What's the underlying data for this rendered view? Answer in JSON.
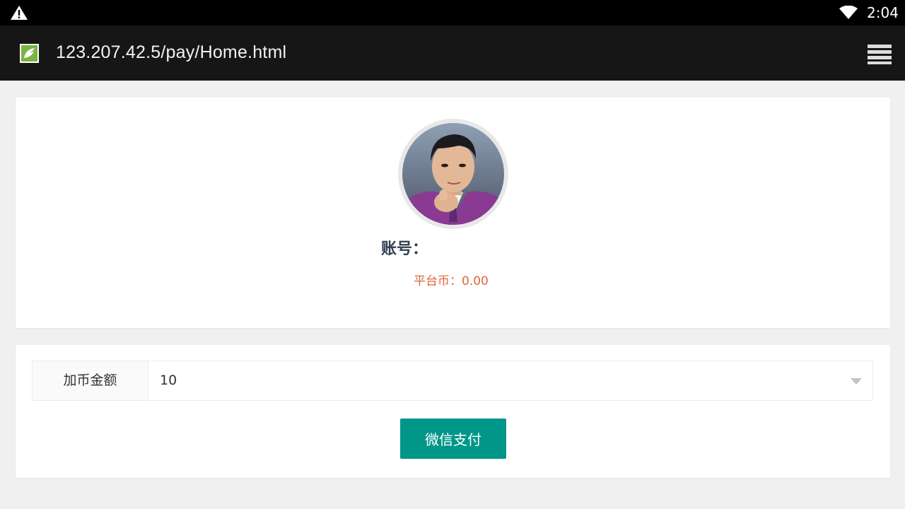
{
  "status_bar": {
    "time": "2:04",
    "icons": [
      "warning-icon",
      "wifi-icon"
    ]
  },
  "app_bar": {
    "url": "123.207.42.5/pay/Home.html",
    "menu_icon": "menu-icon"
  },
  "profile": {
    "avatar_alt": "avatar",
    "account_label": "账号：",
    "coin_line": "平台币：0.00"
  },
  "payment": {
    "amount_label": "加币金额",
    "amount_value": "10",
    "pay_button": "微信支付"
  },
  "colors": {
    "accent": "#009688",
    "coin_text": "#e0653e",
    "account_text": "#2f3e50"
  }
}
